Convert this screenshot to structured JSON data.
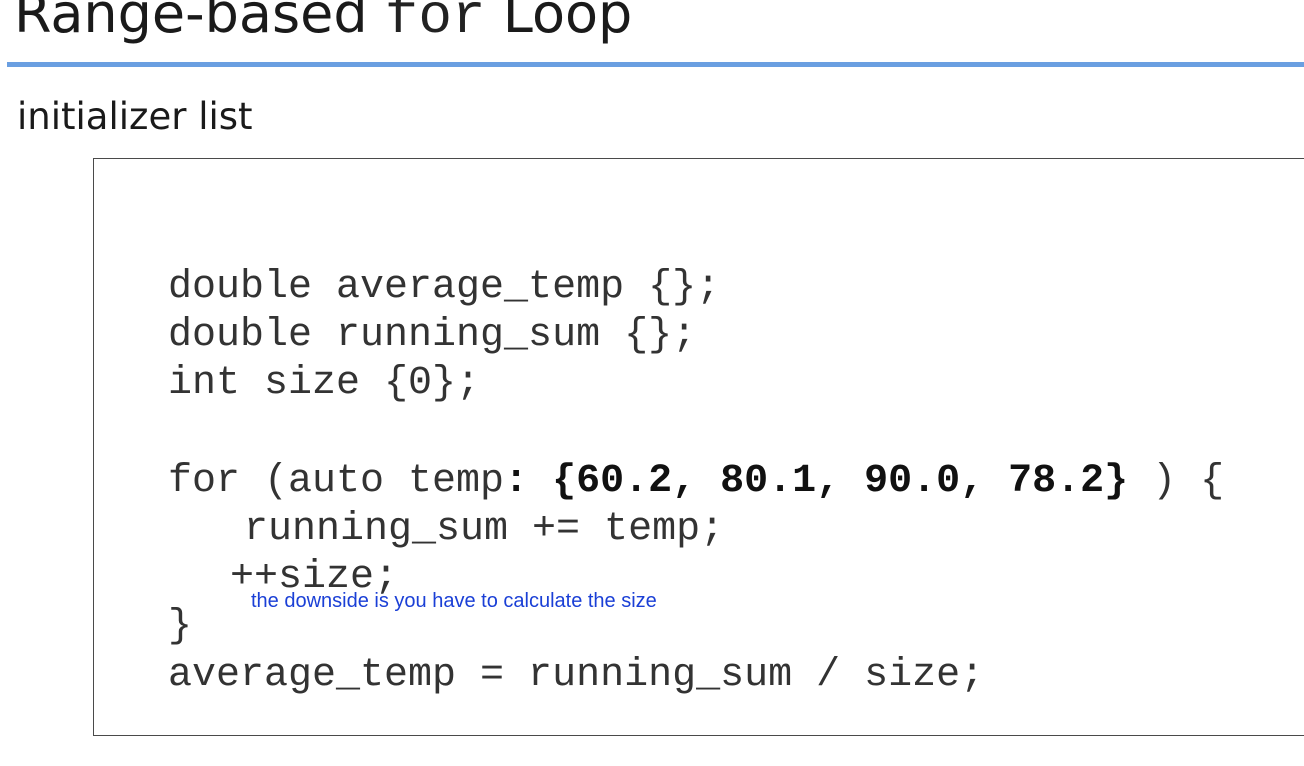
{
  "slide": {
    "title_pre": "Range-based ",
    "title_keyword": "for",
    "title_post": " Loop",
    "subtitle": "initializer list"
  },
  "code": {
    "line1": "double average_temp {};",
    "line2": "double running_sum {};",
    "line3": "int size {0};",
    "line4_pre": "for (auto temp",
    "line4_bold": ": {60.2, 80.1, 90.0, 78.2}",
    "line4_post": " ) {",
    "line5": "running_sum += temp;",
    "line6": "++size;",
    "line7": "}",
    "line8": "average_temp = running_sum / size;"
  },
  "annotation": {
    "text": "the downside is you have to calculate the size"
  },
  "colors": {
    "rule": "#6a9fe1",
    "annotation": "#1a3fd6"
  }
}
